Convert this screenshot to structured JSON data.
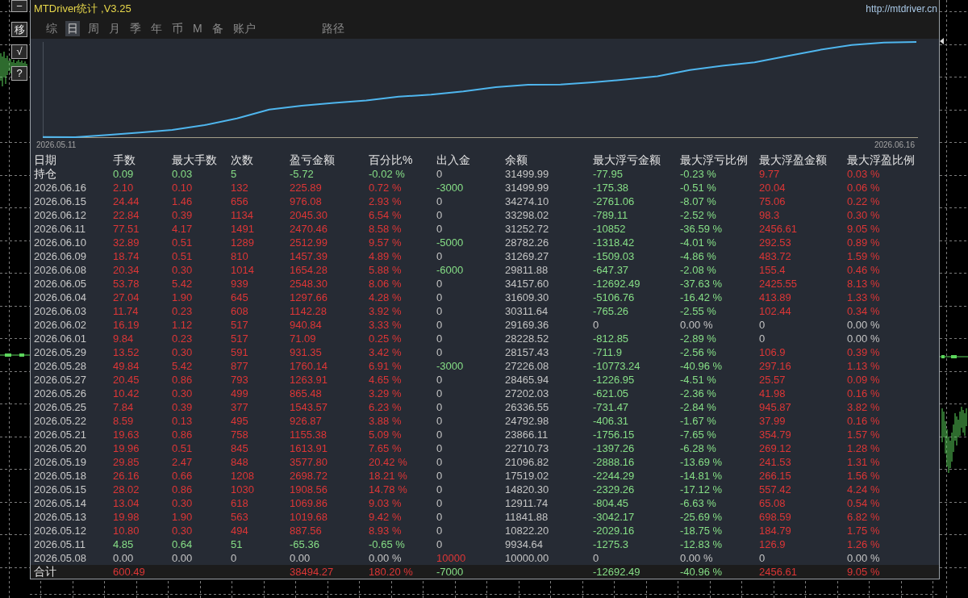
{
  "side_buttons": [
    "−",
    "移",
    "√",
    "?"
  ],
  "window": {
    "title": "MTDriver统计 ,V3.25",
    "url": "http://mtdriver.cn"
  },
  "tabs": [
    {
      "label": "综",
      "selected": false
    },
    {
      "label": "日",
      "selected": true
    },
    {
      "label": "周",
      "selected": false
    },
    {
      "label": "月",
      "selected": false
    },
    {
      "label": "季",
      "selected": false
    },
    {
      "label": "年",
      "selected": false
    },
    {
      "label": "币",
      "selected": false
    },
    {
      "label": "M",
      "selected": false
    },
    {
      "label": "备",
      "selected": false
    },
    {
      "label": "账户",
      "selected": false
    }
  ],
  "path_button": {
    "label": "路径"
  },
  "chart": {
    "start_label": "2026.05.11",
    "end_label": "2026.06.16"
  },
  "table": {
    "columns": [
      "日期",
      "手数",
      "最大手数",
      "次数",
      "盈亏金额",
      "百分比%",
      "出入金",
      "余额",
      "最大浮亏金额",
      "最大浮亏比例",
      "最大浮盈金额",
      "最大浮盈比例"
    ],
    "open_position": {
      "label": "持仓",
      "lots": "0.09",
      "max_lots": "0.03",
      "trades": "5",
      "profit": "-5.72",
      "percent": "-0.02 %",
      "deposit": "0",
      "balance": "31499.99",
      "max_float_loss": "-77.95",
      "max_float_loss_pct": "-0.23 %",
      "max_float_profit": "9.77",
      "max_float_profit_pct": "0.03 %"
    },
    "rows": [
      {
        "date": "2026.06.16",
        "lots": "2.10",
        "max_lots": "0.10",
        "trades": "132",
        "profit": "225.89",
        "percent": "0.72 %",
        "deposit": "-3000",
        "balance": "31499.99",
        "max_float_loss": "-175.38",
        "max_float_loss_pct": "-0.51 %",
        "max_float_profit": "20.04",
        "max_float_profit_pct": "0.06 %"
      },
      {
        "date": "2026.06.15",
        "lots": "24.44",
        "max_lots": "1.46",
        "trades": "656",
        "profit": "976.08",
        "percent": "2.93 %",
        "deposit": "0",
        "balance": "34274.10",
        "max_float_loss": "-2761.06",
        "max_float_loss_pct": "-8.07 %",
        "max_float_profit": "75.06",
        "max_float_profit_pct": "0.22 %"
      },
      {
        "date": "2026.06.12",
        "lots": "22.84",
        "max_lots": "0.39",
        "trades": "1134",
        "profit": "2045.30",
        "percent": "6.54 %",
        "deposit": "0",
        "balance": "33298.02",
        "max_float_loss": "-789.11",
        "max_float_loss_pct": "-2.52 %",
        "max_float_profit": "98.3",
        "max_float_profit_pct": "0.30 %"
      },
      {
        "date": "2026.06.11",
        "lots": "77.51",
        "max_lots": "4.17",
        "trades": "1491",
        "profit": "2470.46",
        "percent": "8.58 %",
        "deposit": "0",
        "balance": "31252.72",
        "max_float_loss": "-10852",
        "max_float_loss_pct": "-36.59 %",
        "max_float_profit": "2456.61",
        "max_float_profit_pct": "9.05 %"
      },
      {
        "date": "2026.06.10",
        "lots": "32.89",
        "max_lots": "0.51",
        "trades": "1289",
        "profit": "2512.99",
        "percent": "9.57 %",
        "deposit": "-5000",
        "balance": "28782.26",
        "max_float_loss": "-1318.42",
        "max_float_loss_pct": "-4.01 %",
        "max_float_profit": "292.53",
        "max_float_profit_pct": "0.89 %"
      },
      {
        "date": "2026.06.09",
        "lots": "18.74",
        "max_lots": "0.51",
        "trades": "810",
        "profit": "1457.39",
        "percent": "4.89 %",
        "deposit": "0",
        "balance": "31269.27",
        "max_float_loss": "-1509.03",
        "max_float_loss_pct": "-4.86 %",
        "max_float_profit": "483.72",
        "max_float_profit_pct": "1.59 %"
      },
      {
        "date": "2026.06.08",
        "lots": "20.34",
        "max_lots": "0.30",
        "trades": "1014",
        "profit": "1654.28",
        "percent": "5.88 %",
        "deposit": "-6000",
        "balance": "29811.88",
        "max_float_loss": "-647.37",
        "max_float_loss_pct": "-2.08 %",
        "max_float_profit": "155.4",
        "max_float_profit_pct": "0.46 %"
      },
      {
        "date": "2026.06.05",
        "lots": "53.78",
        "max_lots": "5.42",
        "trades": "939",
        "profit": "2548.30",
        "percent": "8.06 %",
        "deposit": "0",
        "balance": "34157.60",
        "max_float_loss": "-12692.49",
        "max_float_loss_pct": "-37.63 %",
        "max_float_profit": "2425.55",
        "max_float_profit_pct": "8.13 %"
      },
      {
        "date": "2026.06.04",
        "lots": "27.04",
        "max_lots": "1.90",
        "trades": "645",
        "profit": "1297.66",
        "percent": "4.28 %",
        "deposit": "0",
        "balance": "31609.30",
        "max_float_loss": "-5106.76",
        "max_float_loss_pct": "-16.42 %",
        "max_float_profit": "413.89",
        "max_float_profit_pct": "1.33 %"
      },
      {
        "date": "2026.06.03",
        "lots": "11.74",
        "max_lots": "0.23",
        "trades": "608",
        "profit": "1142.28",
        "percent": "3.92 %",
        "deposit": "0",
        "balance": "30311.64",
        "max_float_loss": "-765.26",
        "max_float_loss_pct": "-2.55 %",
        "max_float_profit": "102.44",
        "max_float_profit_pct": "0.34 %"
      },
      {
        "date": "2026.06.02",
        "lots": "16.19",
        "max_lots": "1.12",
        "trades": "517",
        "profit": "940.84",
        "percent": "3.33 %",
        "deposit": "0",
        "balance": "29169.36",
        "max_float_loss": "0",
        "max_float_loss_pct": "0.00 %",
        "max_float_profit": "0",
        "max_float_profit_pct": "0.00 %"
      },
      {
        "date": "2026.06.01",
        "lots": "9.84",
        "max_lots": "0.23",
        "trades": "517",
        "profit": "71.09",
        "percent": "0.25 %",
        "deposit": "0",
        "balance": "28228.52",
        "max_float_loss": "-812.85",
        "max_float_loss_pct": "-2.89 %",
        "max_float_profit": "0",
        "max_float_profit_pct": "0.00 %"
      },
      {
        "date": "2026.05.29",
        "lots": "13.52",
        "max_lots": "0.30",
        "trades": "591",
        "profit": "931.35",
        "percent": "3.42 %",
        "deposit": "0",
        "balance": "28157.43",
        "max_float_loss": "-711.9",
        "max_float_loss_pct": "-2.56 %",
        "max_float_profit": "106.9",
        "max_float_profit_pct": "0.39 %"
      },
      {
        "date": "2026.05.28",
        "lots": "49.84",
        "max_lots": "5.42",
        "trades": "877",
        "profit": "1760.14",
        "percent": "6.91 %",
        "deposit": "-3000",
        "balance": "27226.08",
        "max_float_loss": "-10773.24",
        "max_float_loss_pct": "-40.96 %",
        "max_float_profit": "297.16",
        "max_float_profit_pct": "1.13 %"
      },
      {
        "date": "2026.05.27",
        "lots": "20.45",
        "max_lots": "0.86",
        "trades": "793",
        "profit": "1263.91",
        "percent": "4.65 %",
        "deposit": "0",
        "balance": "28465.94",
        "max_float_loss": "-1226.95",
        "max_float_loss_pct": "-4.51 %",
        "max_float_profit": "25.57",
        "max_float_profit_pct": "0.09 %"
      },
      {
        "date": "2026.05.26",
        "lots": "10.42",
        "max_lots": "0.30",
        "trades": "499",
        "profit": "865.48",
        "percent": "3.29 %",
        "deposit": "0",
        "balance": "27202.03",
        "max_float_loss": "-621.05",
        "max_float_loss_pct": "-2.36 %",
        "max_float_profit": "41.98",
        "max_float_profit_pct": "0.16 %"
      },
      {
        "date": "2026.05.25",
        "lots": "7.84",
        "max_lots": "0.39",
        "trades": "377",
        "profit": "1543.57",
        "percent": "6.23 %",
        "deposit": "0",
        "balance": "26336.55",
        "max_float_loss": "-731.47",
        "max_float_loss_pct": "-2.84 %",
        "max_float_profit": "945.87",
        "max_float_profit_pct": "3.82 %"
      },
      {
        "date": "2026.05.22",
        "lots": "8.59",
        "max_lots": "0.13",
        "trades": "495",
        "profit": "926.87",
        "percent": "3.88 %",
        "deposit": "0",
        "balance": "24792.98",
        "max_float_loss": "-406.31",
        "max_float_loss_pct": "-1.67 %",
        "max_float_profit": "37.99",
        "max_float_profit_pct": "0.16 %"
      },
      {
        "date": "2026.05.21",
        "lots": "19.63",
        "max_lots": "0.86",
        "trades": "758",
        "profit": "1155.38",
        "percent": "5.09 %",
        "deposit": "0",
        "balance": "23866.11",
        "max_float_loss": "-1756.15",
        "max_float_loss_pct": "-7.65 %",
        "max_float_profit": "354.79",
        "max_float_profit_pct": "1.57 %"
      },
      {
        "date": "2026.05.20",
        "lots": "19.96",
        "max_lots": "0.51",
        "trades": "845",
        "profit": "1613.91",
        "percent": "7.65 %",
        "deposit": "0",
        "balance": "22710.73",
        "max_float_loss": "-1397.26",
        "max_float_loss_pct": "-6.28 %",
        "max_float_profit": "269.12",
        "max_float_profit_pct": "1.28 %"
      },
      {
        "date": "2026.05.19",
        "lots": "29.85",
        "max_lots": "2.47",
        "trades": "848",
        "profit": "3577.80",
        "percent": "20.42 %",
        "deposit": "0",
        "balance": "21096.82",
        "max_float_loss": "-2888.16",
        "max_float_loss_pct": "-13.69 %",
        "max_float_profit": "241.53",
        "max_float_profit_pct": "1.31 %"
      },
      {
        "date": "2026.05.18",
        "lots": "26.16",
        "max_lots": "0.66",
        "trades": "1208",
        "profit": "2698.72",
        "percent": "18.21 %",
        "deposit": "0",
        "balance": "17519.02",
        "max_float_loss": "-2244.29",
        "max_float_loss_pct": "-14.81 %",
        "max_float_profit": "266.15",
        "max_float_profit_pct": "1.56 %"
      },
      {
        "date": "2026.05.15",
        "lots": "28.02",
        "max_lots": "0.86",
        "trades": "1030",
        "profit": "1908.56",
        "percent": "14.78 %",
        "deposit": "0",
        "balance": "14820.30",
        "max_float_loss": "-2329.26",
        "max_float_loss_pct": "-17.12 %",
        "max_float_profit": "557.42",
        "max_float_profit_pct": "4.24 %"
      },
      {
        "date": "2026.05.14",
        "lots": "13.04",
        "max_lots": "0.30",
        "trades": "618",
        "profit": "1069.86",
        "percent": "9.03 %",
        "deposit": "0",
        "balance": "12911.74",
        "max_float_loss": "-804.45",
        "max_float_loss_pct": "-6.63 %",
        "max_float_profit": "65.08",
        "max_float_profit_pct": "0.54 %"
      },
      {
        "date": "2026.05.13",
        "lots": "19.98",
        "max_lots": "1.90",
        "trades": "563",
        "profit": "1019.68",
        "percent": "9.42 %",
        "deposit": "0",
        "balance": "11841.88",
        "max_float_loss": "-3042.17",
        "max_float_loss_pct": "-25.69 %",
        "max_float_profit": "698.59",
        "max_float_profit_pct": "6.82 %"
      },
      {
        "date": "2026.05.12",
        "lots": "10.80",
        "max_lots": "0.30",
        "trades": "494",
        "profit": "887.56",
        "percent": "8.93 %",
        "deposit": "0",
        "balance": "10822.20",
        "max_float_loss": "-2029.16",
        "max_float_loss_pct": "-18.75 %",
        "max_float_profit": "184.79",
        "max_float_profit_pct": "1.75 %"
      },
      {
        "date": "2026.05.11",
        "lots": "4.85",
        "max_lots": "0.64",
        "trades": "51",
        "profit": "-65.36",
        "percent": "-0.65 %",
        "deposit": "0",
        "balance": "9934.64",
        "max_float_loss": "-1275.3",
        "max_float_loss_pct": "-12.83 %",
        "max_float_profit": "126.9",
        "max_float_profit_pct": "1.26 %"
      },
      {
        "date": "2026.05.08",
        "lots": "0.00",
        "max_lots": "0.00",
        "trades": "0",
        "profit": "0.00",
        "percent": "0.00 %",
        "deposit": "10000",
        "balance": "10000.00",
        "max_float_loss": "0",
        "max_float_loss_pct": "0.00 %",
        "max_float_profit": "0",
        "max_float_profit_pct": "0.00 %"
      }
    ],
    "total": {
      "label": "合计",
      "lots": "600.49",
      "profit": "38494.27",
      "percent": "180.20 %",
      "deposit": "-7000",
      "max_float_loss": "-12692.49",
      "max_float_loss_pct": "-40.96 %",
      "max_float_profit": "2456.61",
      "max_float_profit_pct": "9.05 %"
    }
  }
}
